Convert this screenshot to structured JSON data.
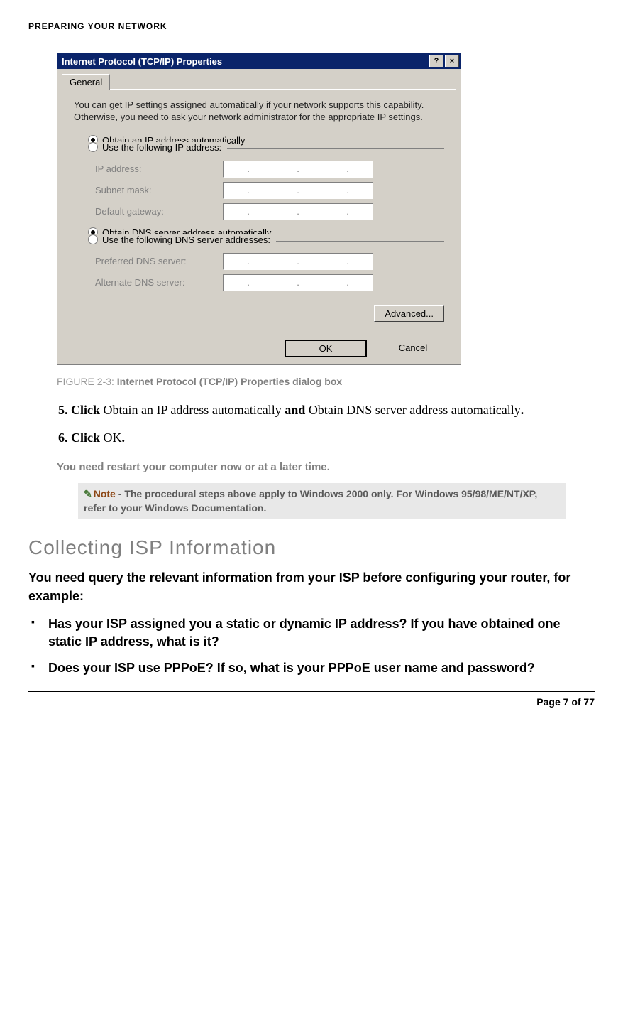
{
  "header": {
    "chapter": "PREPARING YOUR NETWORK"
  },
  "dialog": {
    "title": "Internet Protocol (TCP/IP) Properties",
    "help_glyph": "?",
    "close_glyph": "×",
    "tab": "General",
    "intro": "You can get IP settings assigned automatically if your network supports this capability. Otherwise, you need to ask your network administrator for the appropriate IP settings.",
    "radio_auto_ip": "Obtain an IP address automatically",
    "radio_manual_ip": "Use the following IP address:",
    "ip_fields": {
      "ip_address": "IP address:",
      "subnet_mask": "Subnet mask:",
      "default_gateway": "Default gateway:"
    },
    "radio_auto_dns": "Obtain DNS server address automatically",
    "radio_manual_dns": "Use the following DNS server addresses:",
    "dns_fields": {
      "preferred": "Preferred DNS server:",
      "alternate": "Alternate DNS server:"
    },
    "advanced_btn": "Advanced...",
    "ok_btn": "OK",
    "cancel_btn": "Cancel"
  },
  "figure": {
    "label": "FIGURE 2-3:",
    "caption": "Internet Protocol (TCP/IP) Properties dialog box"
  },
  "steps": {
    "item5_pre": "Click",
    "item5_mid": " Obtain an IP address automatically ",
    "item5_bold2": "and",
    "item5_rest": " Obtain DNS server address automatically",
    "item5_end": ".",
    "item6_pre": "Click",
    "item6_mid": " OK",
    "item6_end": "."
  },
  "restart_note": "You need restart your computer now or at a later time.",
  "note": {
    "pencil": "✎",
    "label": "Note",
    "sep": " - ",
    "text": "The procedural steps above apply to Windows 2000 only. For Windows 95/98/ME/NT/XP, refer to your Windows Documentation."
  },
  "section_heading": "Collecting ISP Information",
  "section_intro": "You need query the relevant information from your ISP before configuring your router, for example:",
  "bullets": [
    "Has your ISP assigned you a static or dynamic IP address? If you have obtained one static IP address, what is it?",
    "Does your ISP use PPPoE? If so, what is your PPPoE user name and password?"
  ],
  "footer": "Page 7 of 77"
}
